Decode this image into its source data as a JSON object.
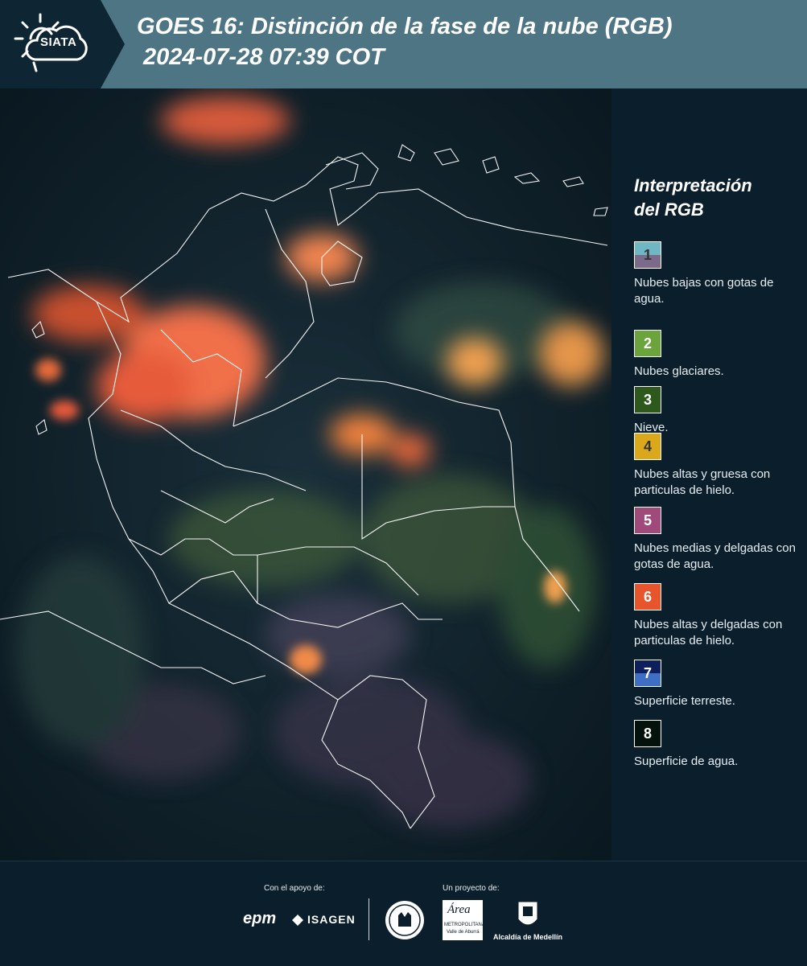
{
  "header": {
    "logo_text": "SIATA",
    "title_line1": "GOES 16: Distinción de la fase de la nube (RGB)",
    "title_line2": "2024-07-28 07:39 COT"
  },
  "legend": {
    "title_line1": "Interpretación",
    "title_line2": "del RGB",
    "items": [
      {
        "number": "1",
        "label": "Nubes bajas con gotas de agua.",
        "color_top": "#6fb7c4",
        "color_bottom": "#7c6a8a",
        "num_color": "#333333"
      },
      {
        "number": "2",
        "label": "Nubes glaciares.",
        "color_top": "#6aa43a",
        "color_bottom": "#6aa43a",
        "num_color": "#ffffff"
      },
      {
        "number": "3",
        "label": "Nieve.",
        "color_top": "#2d5a1c",
        "color_bottom": "#2d5a1c",
        "num_color": "#ffffff"
      },
      {
        "number": "4",
        "label": "Nubes altas y gruesa con particulas de hielo.",
        "color_top": "#d9a91b",
        "color_bottom": "#d9a91b",
        "num_color": "#333333"
      },
      {
        "number": "5",
        "label": "Nubes medias y delgadas con gotas de agua.",
        "color_top": "#a04a7c",
        "color_bottom": "#a04a7c",
        "num_color": "#ffffff"
      },
      {
        "number": "6",
        "label": "Nubes altas y delgadas con particulas de hielo.",
        "color_top": "#e8542c",
        "color_bottom": "#e8542c",
        "num_color": "#ffffff"
      },
      {
        "number": "7",
        "label": "Superficie terreste.",
        "color_top": "#0d1f5c",
        "color_bottom": "#3f6fc4",
        "num_color": "#ffffff"
      },
      {
        "number": "8",
        "label": "Superficie de agua.",
        "color_top": "#05120c",
        "color_bottom": "#05120c",
        "num_color": "#ffffff"
      }
    ]
  },
  "footer": {
    "support_label": "Con el apoyo de:",
    "project_label": "Un proyecto de:",
    "sponsor1": "epm",
    "sponsor2": "ISAGEN",
    "partner2_line1": "Área",
    "partner2_line2": "METROPOLITANA",
    "partner2_line3": "Valle de Aburrá",
    "partner3": "Alcaldía de Medellín"
  }
}
